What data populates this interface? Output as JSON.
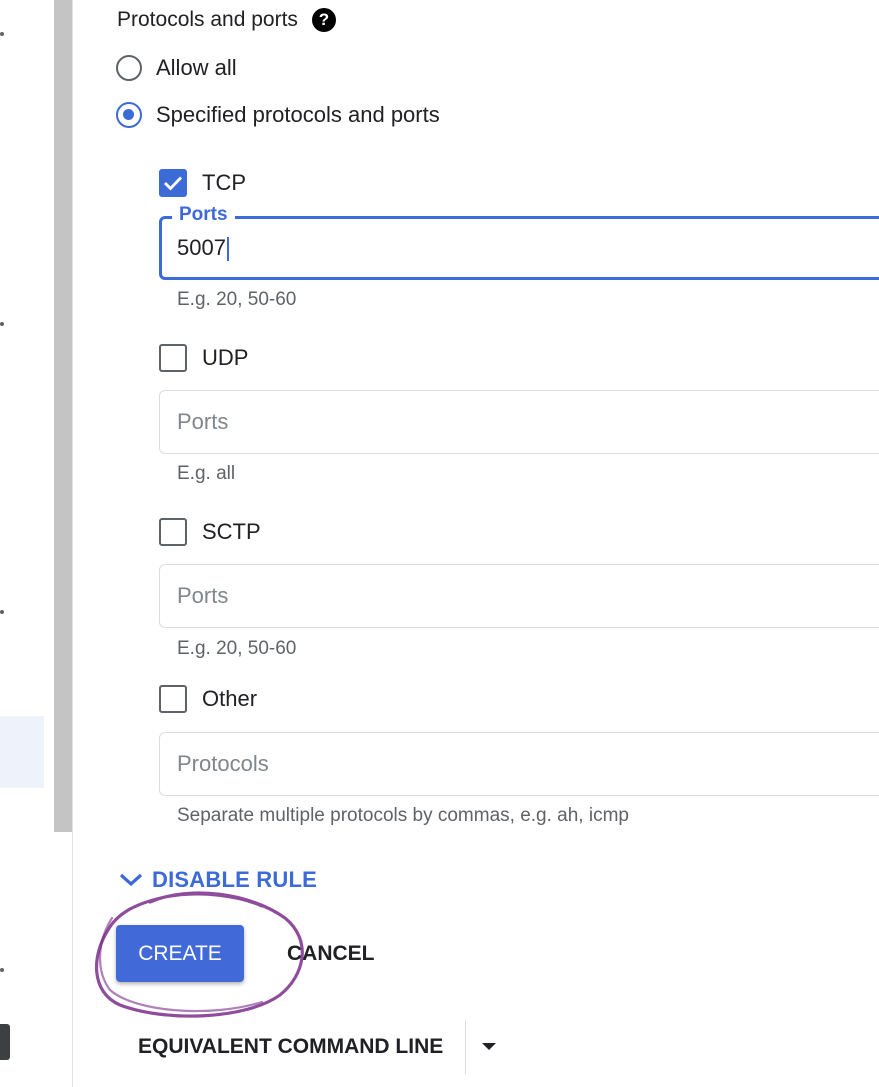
{
  "section": {
    "title": "Protocols and ports",
    "help_icon": "help-circle-icon"
  },
  "options": {
    "allow_all": "Allow all",
    "specified": "Specified protocols and ports",
    "selected": "specified"
  },
  "tcp": {
    "label": "TCP",
    "checked": true,
    "field_label": "Ports",
    "value": "5007",
    "hint": "E.g. 20, 50-60"
  },
  "udp": {
    "label": "UDP",
    "checked": false,
    "placeholder": "Ports",
    "hint": "E.g. all"
  },
  "sctp": {
    "label": "SCTP",
    "checked": false,
    "placeholder": "Ports",
    "hint": "E.g. 20, 50-60"
  },
  "other": {
    "label": "Other",
    "checked": false,
    "placeholder": "Protocols",
    "hint": "Separate multiple protocols by commas, e.g. ah, icmp"
  },
  "actions": {
    "disable_rule": "DISABLE RULE",
    "create": "CREATE",
    "cancel": "CANCEL",
    "equivalent_command_line": "EQUIVALENT COMMAND LINE"
  },
  "colors": {
    "accent": "#3c6ad6",
    "create_button": "#4169d8",
    "annotation": "#7b2d8b"
  }
}
